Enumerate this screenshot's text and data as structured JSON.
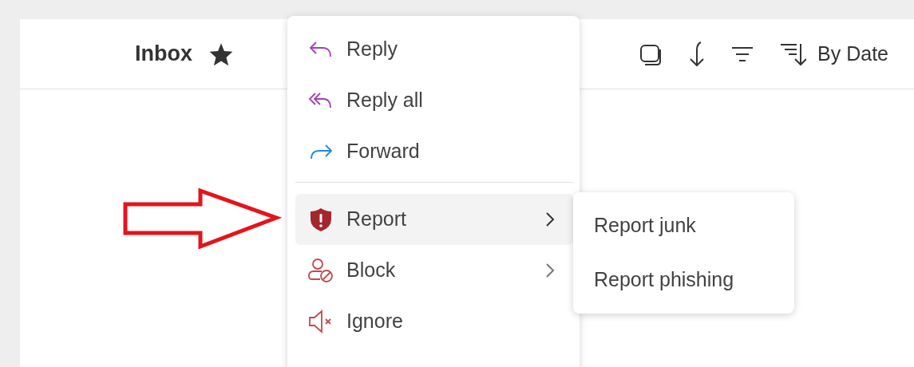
{
  "header": {
    "title": "Inbox",
    "favorite": true,
    "sort_label": "By Date"
  },
  "context_menu": {
    "groups": [
      [
        {
          "label": "Reply",
          "has_submenu": false,
          "selected": false
        },
        {
          "label": "Reply all",
          "has_submenu": false,
          "selected": false
        },
        {
          "label": "Forward",
          "has_submenu": false,
          "selected": false
        }
      ],
      [
        {
          "label": "Report",
          "has_submenu": true,
          "selected": true
        },
        {
          "label": "Block",
          "has_submenu": true,
          "selected": false
        },
        {
          "label": "Ignore",
          "has_submenu": false,
          "selected": false
        }
      ]
    ]
  },
  "submenu": {
    "items": [
      {
        "label": "Report junk"
      },
      {
        "label": "Report phishing"
      }
    ]
  }
}
